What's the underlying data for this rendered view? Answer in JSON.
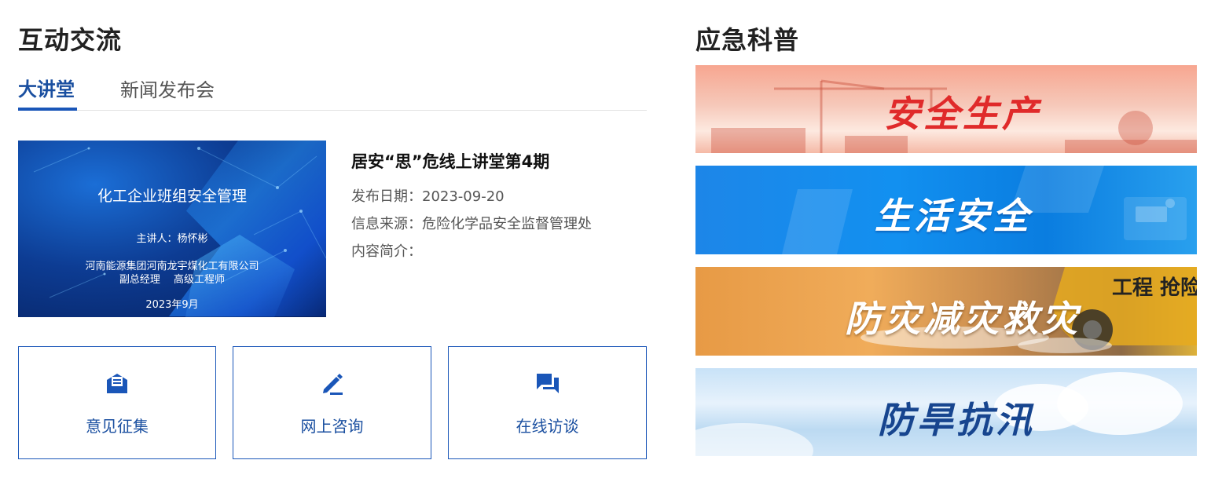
{
  "left": {
    "title": "互动交流",
    "tabs": [
      {
        "label": "大讲堂",
        "active": true
      },
      {
        "label": "新闻发布会",
        "active": false
      }
    ],
    "thumbnail": {
      "heading": "化工企业班组安全管理",
      "speaker": "主讲人：杨怀彬",
      "org": "河南能源集团河南龙宇煤化工有限公司",
      "role": "副总经理　 高级工程师",
      "date": "2023年9月"
    },
    "article": {
      "title": "居安“思”危线上讲堂第4期",
      "date_label": "发布日期：",
      "date_value": "2023-09-20",
      "source_label": "信息来源：",
      "source_value": "危险化学品安全监督管理处",
      "summary_label": "内容简介："
    },
    "services": [
      {
        "label": "意见征集",
        "icon": "mail-document-icon"
      },
      {
        "label": "网上咨询",
        "icon": "pen-icon"
      },
      {
        "label": "在线访谈",
        "icon": "chat-bubbles-icon"
      }
    ]
  },
  "right": {
    "title": "应急科普",
    "banners": [
      {
        "label": "安全生产",
        "text_color": "#e02a2a"
      },
      {
        "label": "生活安全",
        "text_color": "#ffffff"
      },
      {
        "label": "防灾减灾救灾",
        "text_color": "#ffffff"
      },
      {
        "label": "防旱抗汛",
        "text_color": "#17458f"
      }
    ]
  },
  "colors": {
    "accent": "#1a56b8",
    "tab_active": "#1a4fa0"
  }
}
